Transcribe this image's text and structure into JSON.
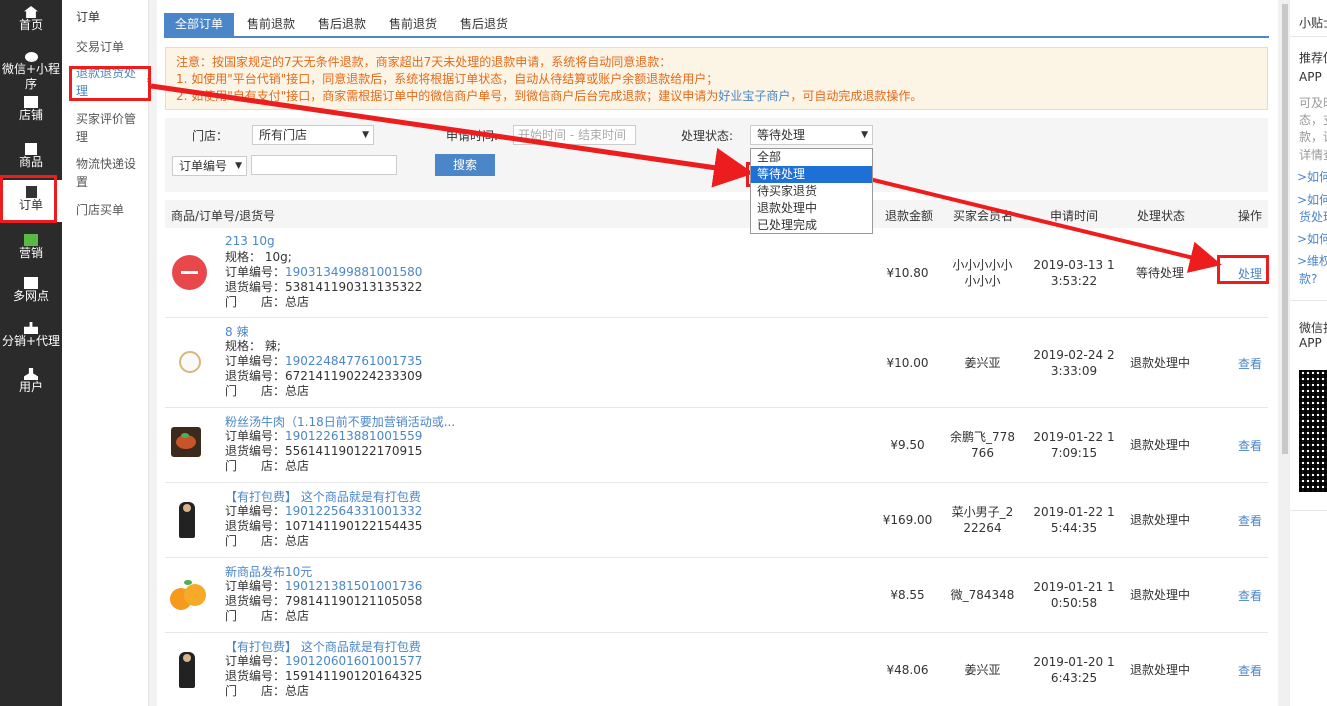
{
  "left_nav": [
    {
      "label": "首页",
      "icon": "home-icon"
    },
    {
      "label": "微信+小程序",
      "icon": "wechat-icon"
    },
    {
      "label": "店铺",
      "icon": "store-icon"
    },
    {
      "label": "商品",
      "icon": "product-icon"
    },
    {
      "label": "订单",
      "icon": "order-icon",
      "active": true
    },
    {
      "label": "营销",
      "icon": "marketing-icon"
    },
    {
      "label": "多网点",
      "icon": "branches-icon"
    },
    {
      "label": "分销+代理",
      "icon": "distribution-icon"
    },
    {
      "label": "用户",
      "icon": "user-icon"
    }
  ],
  "sub_nav": {
    "title": "订单",
    "items": [
      {
        "label": "交易订单"
      },
      {
        "label": "退款退货处理",
        "active": true
      },
      {
        "label": "买家评价管理"
      },
      {
        "label": "物流快递设置"
      },
      {
        "label": "门店买单"
      }
    ]
  },
  "tabs": [
    "全部订单",
    "售前退款",
    "售后退款",
    "售前退货",
    "售后退货"
  ],
  "notice": {
    "line1": "注意：按国家规定的7天无条件退款，商家超出7天未处理的退款申请，系统将自动同意退款：",
    "line2": "1. 如使用\"平台代销\"接口，同意退款后，系统将根据订单状态，自动从待结算或账户余额退款给用户；",
    "line3_a": "2. 如使用\"自有支付\"接口，商家需根据订单中的微信商户单号，到微信商户后台完成退款；建议申请为",
    "line3_link": "好业宝子商户",
    "line3_b": "，可自动完成退款操作。"
  },
  "filters": {
    "store_label": "门店：",
    "store_value": "所有门店",
    "date_label": "申请时间:",
    "date_placeholder": "开始时间 - 结束时间",
    "status_label": "处理状态:",
    "status_value": "等待处理",
    "order_type": "订单编号",
    "search_button": "搜索"
  },
  "status_options": [
    "全部",
    "等待处理",
    "待买家退货",
    "退款处理中",
    "已处理完成"
  ],
  "table": {
    "headers": {
      "product": "商品/订单号/退货号",
      "amount": "退款金额",
      "buyer": "买家会员名",
      "time": "申请时间",
      "status": "处理状态",
      "op": "操作"
    },
    "rows": [
      {
        "name": "213 10g",
        "spec": "规格： 10g;",
        "order_label": "订单编号：",
        "order_no": "190313499881001580",
        "return_label": "退货编号：",
        "return_no": "538141190313135322",
        "store": "门　　店：总店",
        "amount": "¥10.80",
        "buyer1": "小小小小小",
        "buyer2": "小小小",
        "time1": "2019-03-13 1",
        "time2": "3:53:22",
        "status": "等待处理",
        "op": "处理",
        "thumb": "minus"
      },
      {
        "name": "8 辣",
        "spec": "规格： 辣;",
        "order_label": "订单编号：",
        "order_no": "190224847761001735",
        "return_label": "退货编号：",
        "return_no": "672141190224233309",
        "store": "门　　店：总店",
        "amount": "¥10.00",
        "buyer1": "姜兴亚",
        "buyer2": "",
        "time1": "2019-02-24 2",
        "time2": "3:33:09",
        "status": "退款处理中",
        "op": "查看",
        "thumb": "clock"
      },
      {
        "name": "粉丝汤牛肉（1.18日前不要加营销活动或...",
        "spec": "",
        "order_label": "订单编号：",
        "order_no": "190122613881001559",
        "return_label": "退货编号：",
        "return_no": "556141190122170915",
        "store": "门　　店：总店",
        "amount": "¥9.50",
        "buyer1": "余鹏飞_778",
        "buyer2": "766",
        "time1": "2019-01-22 1",
        "time2": "7:09:15",
        "status": "退款处理中",
        "op": "查看",
        "thumb": "food"
      },
      {
        "name": "【有打包费】 这个商品就是有打包费",
        "spec": "",
        "order_label": "订单编号：",
        "order_no": "190122564331001332",
        "return_label": "退货编号：",
        "return_no": "107141190122154435",
        "store": "门　　店：总店",
        "amount": "¥169.00",
        "buyer1": "菜小男子_2",
        "buyer2": "22264",
        "time1": "2019-01-22 1",
        "time2": "5:44:35",
        "status": "退款处理中",
        "op": "查看",
        "thumb": "person"
      },
      {
        "name": "新商品发布10元",
        "spec": "",
        "order_label": "订单编号：",
        "order_no": "190121381501001736",
        "return_label": "退货编号：",
        "return_no": "798141190121105058",
        "store": "门　　店：总店",
        "amount": "¥8.55",
        "buyer1": "微_784348",
        "buyer2": "",
        "time1": "2019-01-21 1",
        "time2": "0:50:58",
        "status": "退款处理中",
        "op": "查看",
        "thumb": "orange"
      },
      {
        "name": "【有打包费】 这个商品就是有打包费",
        "spec": "",
        "order_label": "订单编号：",
        "order_no": "190120601601001577",
        "return_label": "退货编号：",
        "return_no": "159141190120164325",
        "store": "门　　店：总店",
        "amount": "¥48.06",
        "buyer1": "姜兴亚",
        "buyer2": "",
        "time1": "2019-01-20 1",
        "time2": "6:43:25",
        "status": "退款处理中",
        "op": "查看",
        "thumb": "person"
      }
    ]
  },
  "right_panel": {
    "title": "小贴士",
    "rec": "推荐使",
    "app": "APP",
    "grey": [
      "可及时",
      "态，支",
      "款，详",
      "详情查"
    ],
    "links": [
      ">如何",
      ">如何",
      "货处理",
      ">如何",
      ">维权",
      "款?"
    ],
    "wechat": "微信扫",
    "app2": "APP"
  },
  "colors": {
    "accent": "#4a86c8",
    "annotation": "#ee1d1d",
    "notice_text": "#e46a1a",
    "nav_bg": "#2b2b2b"
  }
}
